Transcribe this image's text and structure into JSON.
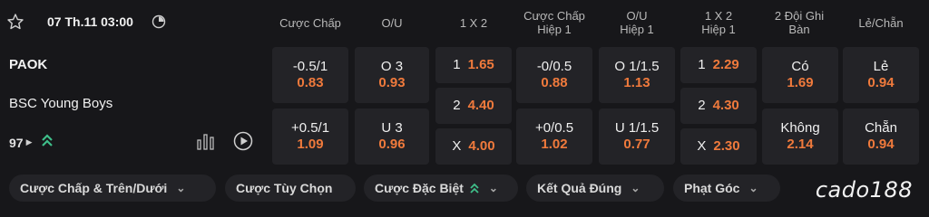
{
  "match": {
    "date_time": "07 Th.11 03:00",
    "home_team": "PAOK",
    "away_team": "BSC Young Boys",
    "market_count": "97"
  },
  "headers": {
    "handicap": "Cược Chấp",
    "ou": "O/U",
    "x12": "1 X 2",
    "handicap_h1_a": "Cược Chấp",
    "handicap_h1_b": "Hiệp 1",
    "ou_h1_a": "O/U",
    "ou_h1_b": "Hiệp 1",
    "x12_h1_a": "1 X 2",
    "x12_h1_b": "Hiệp 1",
    "btts_a": "2 Đội Ghi",
    "btts_b": "Bàn",
    "oddeven": "Lẻ/Chẵn"
  },
  "odds": {
    "handicap": [
      {
        "label": "-0.5/1",
        "odd": "0.83"
      },
      {
        "label": "+0.5/1",
        "odd": "1.09"
      }
    ],
    "ou": [
      {
        "label": "O 3",
        "odd": "0.93"
      },
      {
        "label": "U 3",
        "odd": "0.96"
      }
    ],
    "x12": [
      {
        "label": "1",
        "odd": "1.65"
      },
      {
        "label": "2",
        "odd": "4.40"
      },
      {
        "label": "X",
        "odd": "4.00"
      }
    ],
    "handicap_h1": [
      {
        "label": "-0/0.5",
        "odd": "0.88"
      },
      {
        "label": "+0/0.5",
        "odd": "1.02"
      }
    ],
    "ou_h1": [
      {
        "label": "O 1/1.5",
        "odd": "1.13"
      },
      {
        "label": "U 1/1.5",
        "odd": "0.77"
      }
    ],
    "x12_h1": [
      {
        "label": "1",
        "odd": "2.29"
      },
      {
        "label": "2",
        "odd": "4.30"
      },
      {
        "label": "X",
        "odd": "2.30"
      }
    ],
    "btts": [
      {
        "label": "Có",
        "odd": "1.69"
      },
      {
        "label": "Không",
        "odd": "2.14"
      }
    ],
    "oddeven": [
      {
        "label": "Lẻ",
        "odd": "0.94"
      },
      {
        "label": "Chẵn",
        "odd": "0.94"
      }
    ]
  },
  "tabs": [
    {
      "label": "Cược Chấp & Trên/Dưới"
    },
    {
      "label": "Cược Tùy Chọn"
    },
    {
      "label": "Cược Đặc Biệt"
    },
    {
      "label": "Kết Quả Đúng"
    },
    {
      "label": "Phạt Góc"
    }
  ],
  "brand": "cado188",
  "colors": {
    "background": "#17171a",
    "cell": "#232327",
    "odd": "#f07a3c",
    "accent_green": "#3fbf8a"
  }
}
